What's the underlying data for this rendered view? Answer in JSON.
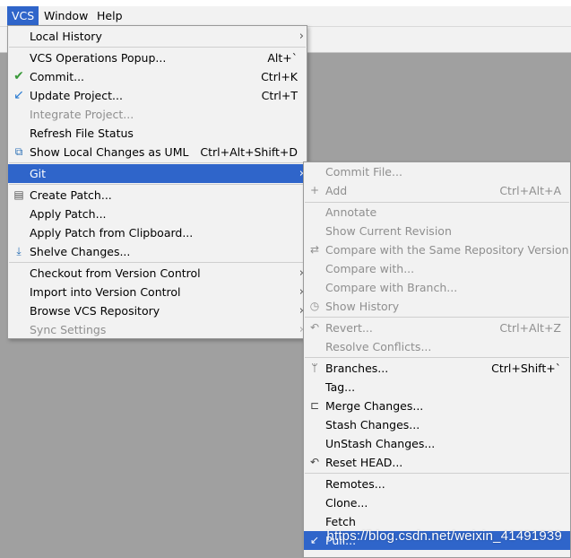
{
  "menubar": {
    "vcs": "VCS",
    "window": "Window",
    "help": "Help"
  },
  "vcs_menu": {
    "local_history": "Local History",
    "operations_popup": {
      "label": "VCS Operations Popup...",
      "shortcut": "Alt+`"
    },
    "commit": {
      "label": "Commit...",
      "shortcut": "Ctrl+K"
    },
    "update_project": {
      "label": "Update Project...",
      "shortcut": "Ctrl+T"
    },
    "integrate_project": "Integrate Project...",
    "refresh_file_status": "Refresh File Status",
    "show_local_changes_uml": {
      "label": "Show Local Changes as UML",
      "shortcut": "Ctrl+Alt+Shift+D"
    },
    "git": "Git",
    "create_patch": "Create Patch...",
    "apply_patch": "Apply Patch...",
    "apply_patch_clipboard": "Apply Patch from Clipboard...",
    "shelve_changes": "Shelve Changes...",
    "checkout_vc": "Checkout from Version Control",
    "import_vc": "Import into Version Control",
    "browse_vcs": "Browse VCS Repository",
    "sync_settings": "Sync Settings"
  },
  "git_menu": {
    "commit_file": "Commit File...",
    "add": {
      "label": "Add",
      "shortcut": "Ctrl+Alt+A"
    },
    "annotate": "Annotate",
    "show_current_revision": "Show Current Revision",
    "compare_same_repo": "Compare with the Same Repository Version",
    "compare_with": "Compare with...",
    "compare_with_branch": "Compare with Branch...",
    "show_history": "Show History",
    "revert": {
      "label": "Revert...",
      "shortcut": "Ctrl+Alt+Z"
    },
    "resolve_conflicts": "Resolve Conflicts...",
    "branches": {
      "label": "Branches...",
      "shortcut": "Ctrl+Shift+`"
    },
    "tag": "Tag...",
    "merge_changes": "Merge Changes...",
    "stash_changes": "Stash Changes...",
    "unstash_changes": "UnStash Changes...",
    "reset_head": "Reset HEAD...",
    "remotes": "Remotes...",
    "clone": "Clone...",
    "fetch": "Fetch",
    "pull": "Pull..."
  },
  "watermark": "https://blog.csdn.net/weixin_41491939",
  "colors": {
    "selection": "#2f65ca",
    "menu_bg": "#f2f2f2",
    "disabled_text": "#8f8f8f",
    "commit_check": "#3a9a3a",
    "update_arrow": "#2a7bd1"
  }
}
